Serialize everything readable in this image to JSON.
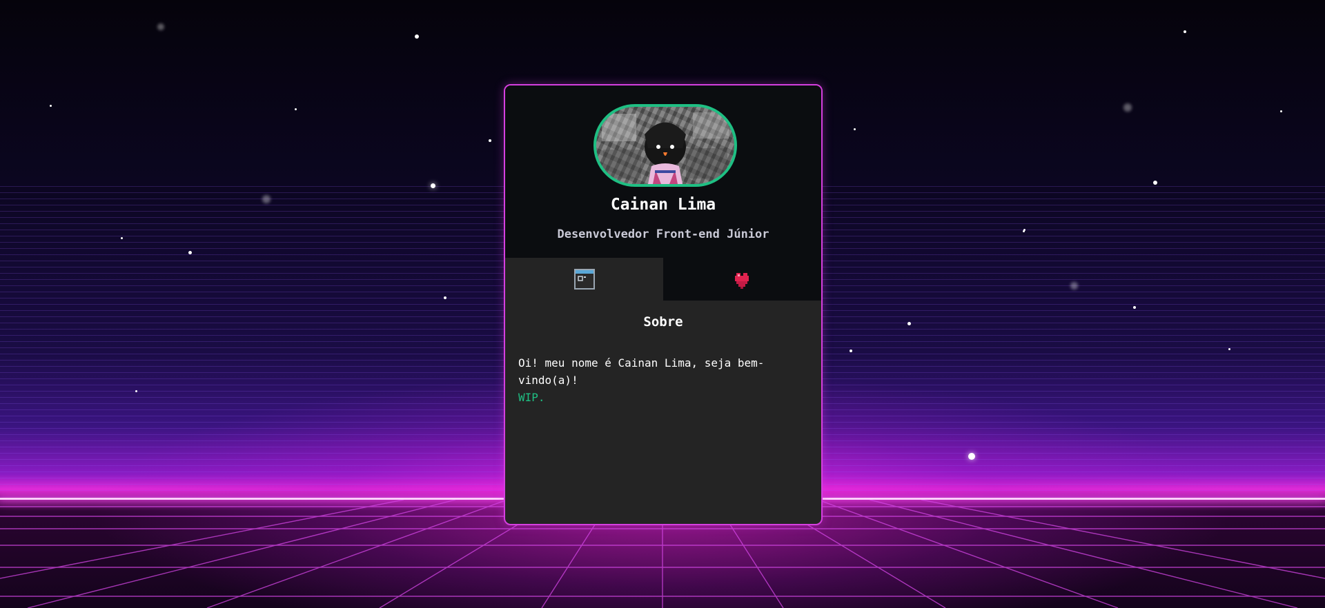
{
  "profile": {
    "name": "Cainan Lima",
    "role": "Desenvolvedor Front-end Júnior"
  },
  "tabs": [
    {
      "icon": "window-icon",
      "active": true
    },
    {
      "icon": "heart-icon",
      "active": false
    }
  ],
  "content": {
    "title": "Sobre",
    "about": "Oi! meu nome é Cainan Lima, seja bem-vindo(a)!",
    "wip": "WIP."
  },
  "colors": {
    "card_border": "#d63fe0",
    "avatar_border": "#1fbf83",
    "wip_text": "#1fbf83",
    "header_bg": "#0b0d10",
    "body_bg": "#242424"
  }
}
